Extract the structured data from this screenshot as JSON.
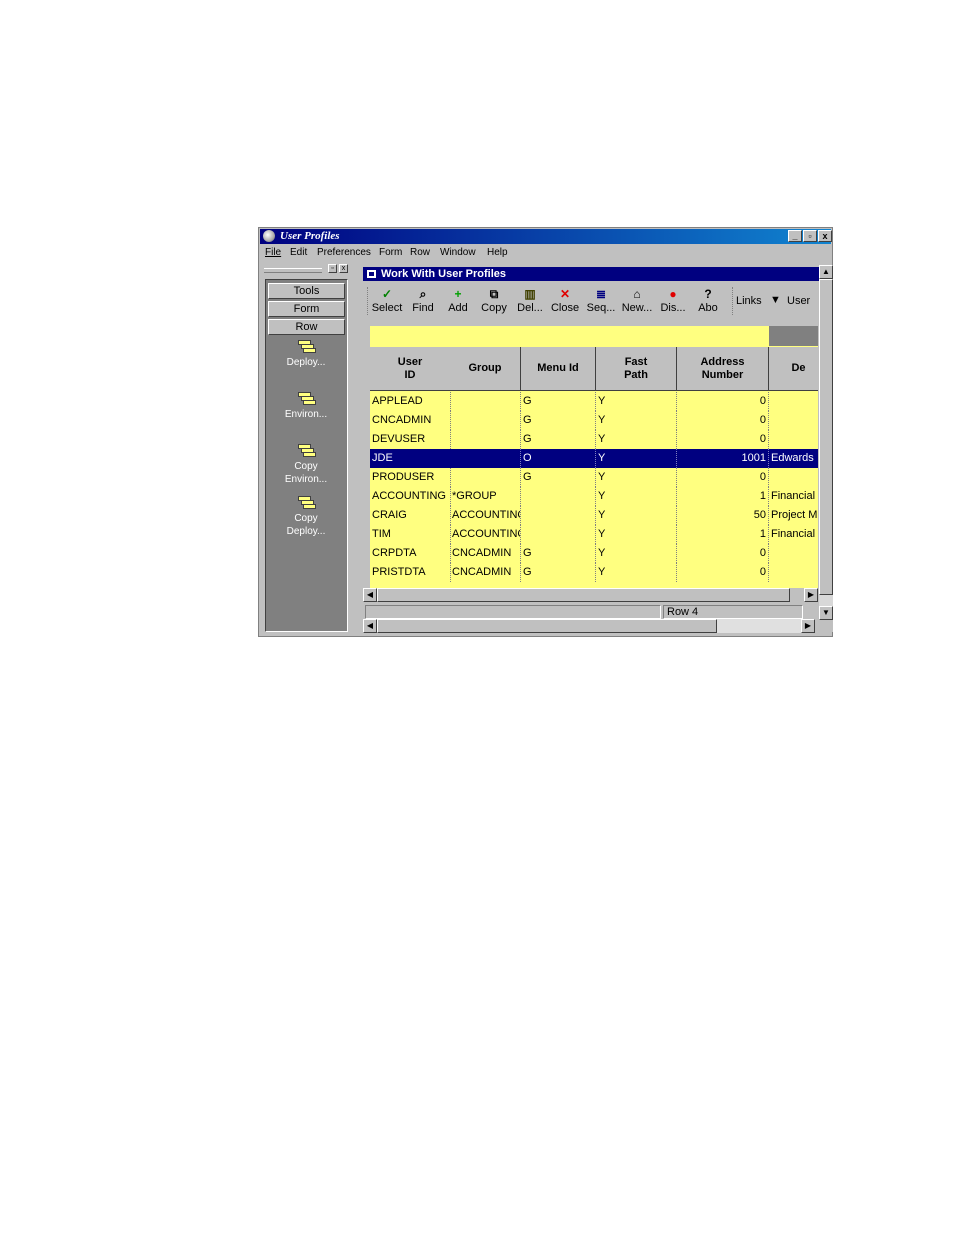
{
  "window": {
    "title": "User Profiles",
    "controls": {
      "minimize": "_",
      "maximize": "▫",
      "close": "x"
    }
  },
  "menu": [
    "File",
    "Edit",
    "Preferences",
    "Form",
    "Row",
    "Window",
    "Help"
  ],
  "left_panel": {
    "tabs": [
      "Tools",
      "Form",
      "Row"
    ],
    "items": [
      {
        "line1": "Deploy...",
        "line2": ""
      },
      {
        "line1": "Environ...",
        "line2": ""
      },
      {
        "line1": "Copy",
        "line2": "Environ..."
      },
      {
        "line1": "Copy",
        "line2": "Deploy..."
      }
    ]
  },
  "form": {
    "title": "Work With User Profiles",
    "toolbar": [
      {
        "label": "Select",
        "icon": "checkmark-icon",
        "glyph": "✓",
        "color": "#008000"
      },
      {
        "label": "Find",
        "icon": "find-icon",
        "glyph": "⌕",
        "color": "#000000"
      },
      {
        "label": "Add",
        "icon": "add-icon",
        "glyph": "+",
        "color": "#00a000"
      },
      {
        "label": "Copy",
        "icon": "copy-icon",
        "glyph": "⧉",
        "color": "#000000"
      },
      {
        "label": "Del...",
        "icon": "trash-icon",
        "glyph": "▥",
        "color": "#404000"
      },
      {
        "label": "Close",
        "icon": "close-icon",
        "glyph": "✕",
        "color": "#e00000"
      },
      {
        "label": "Seq...",
        "icon": "sequence-icon",
        "glyph": "≣",
        "color": "#000080"
      },
      {
        "label": "New...",
        "icon": "folder-icon",
        "glyph": "⌂",
        "color": "#000000"
      },
      {
        "label": "Dis...",
        "icon": "display-icon",
        "glyph": "●",
        "color": "#e00000"
      },
      {
        "label": "Abo",
        "icon": "help-icon",
        "glyph": "?",
        "color": "#000000"
      }
    ],
    "links_label": "Links",
    "links_value": "User"
  },
  "grid": {
    "columns": [
      {
        "line1": "User",
        "line2": "ID"
      },
      {
        "line1": "Group",
        "line2": ""
      },
      {
        "line1": "Menu Id",
        "line2": ""
      },
      {
        "line1": "Fast",
        "line2": "Path"
      },
      {
        "line1": "Address",
        "line2": "Number"
      },
      {
        "line1": "De",
        "line2": ""
      }
    ],
    "rows": [
      {
        "user_id": "APPLEAD",
        "group": "",
        "menu_id": "G",
        "fast_path": "Y",
        "address": "0",
        "desc": ""
      },
      {
        "user_id": "CNCADMIN",
        "group": "",
        "menu_id": "G",
        "fast_path": "Y",
        "address": "0",
        "desc": ""
      },
      {
        "user_id": "DEVUSER",
        "group": "",
        "menu_id": "G",
        "fast_path": "Y",
        "address": "0",
        "desc": ""
      },
      {
        "user_id": "JDE",
        "group": "",
        "menu_id": "O",
        "fast_path": "Y",
        "address": "1001",
        "desc": "Edwards"
      },
      {
        "user_id": "PRODUSER",
        "group": "",
        "menu_id": "G",
        "fast_path": "Y",
        "address": "0",
        "desc": ""
      },
      {
        "user_id": "ACCOUNTING",
        "group": "*GROUP",
        "menu_id": "",
        "fast_path": "Y",
        "address": "1",
        "desc": "Financial"
      },
      {
        "user_id": "CRAIG",
        "group": "ACCOUNTING",
        "menu_id": "",
        "fast_path": "Y",
        "address": "50",
        "desc": "Project M"
      },
      {
        "user_id": "TIM",
        "group": "ACCOUNTING",
        "menu_id": "",
        "fast_path": "Y",
        "address": "1",
        "desc": "Financial"
      },
      {
        "user_id": "CRPDTA",
        "group": "CNCADMIN",
        "menu_id": "G",
        "fast_path": "Y",
        "address": "0",
        "desc": ""
      },
      {
        "user_id": "PRISTDTA",
        "group": "CNCADMIN",
        "menu_id": "G",
        "fast_path": "Y",
        "address": "0",
        "desc": ""
      }
    ],
    "selected_row": 3
  },
  "status": {
    "row": "Row 4"
  }
}
